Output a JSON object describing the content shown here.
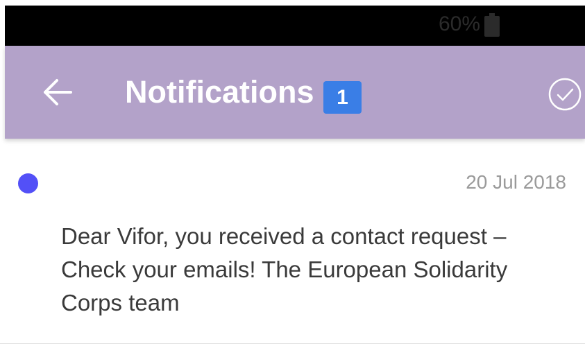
{
  "status_bar": {
    "battery_percent": "60%",
    "battery_icon": "battery-icon"
  },
  "app_bar": {
    "back_icon": "arrow-left-icon",
    "title": "Notifications",
    "badge_count": "1",
    "mark_read_icon": "check-circle-icon"
  },
  "notification": {
    "unread_indicator_color": "#5350f7",
    "date": "20 Jul 2018",
    "message": "Dear Vifor, you received a contact request – Check your emails! The European Solidarity Corps team"
  },
  "colors": {
    "app_bar": "#b3a2c9",
    "badge": "#3a7ee6"
  }
}
